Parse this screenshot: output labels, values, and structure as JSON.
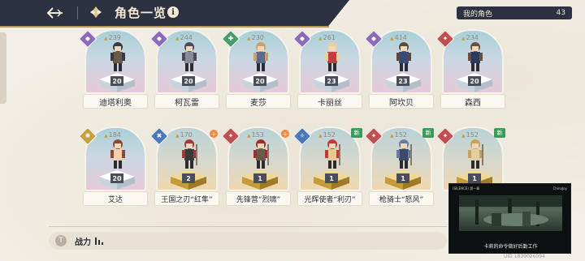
{
  "header": {
    "title": "角色一览",
    "info_symbol": "i"
  },
  "my_roles": {
    "label": "我的角色",
    "count": "43"
  },
  "row1": [
    {
      "name": "迪塔利奥",
      "power": "239",
      "level": "20",
      "class_icon": "magic-icon",
      "class_color": "purple"
    },
    {
      "name": "柯瓦雷",
      "power": "244",
      "level": "20",
      "class_icon": "magic-icon",
      "class_color": "purple"
    },
    {
      "name": "麦莎",
      "power": "230",
      "level": "20",
      "class_icon": "support-icon",
      "class_color": "green"
    },
    {
      "name": "卡丽丝",
      "power": "261",
      "level": "23",
      "class_icon": "magic-icon",
      "class_color": "purple"
    },
    {
      "name": "阿坎贝",
      "power": "414",
      "level": "23",
      "class_icon": "magic-icon",
      "class_color": "purple"
    },
    {
      "name": "森西",
      "power": "234",
      "level": "20",
      "class_icon": "attack-icon",
      "class_color": "red"
    }
  ],
  "row2": [
    {
      "name": "艾达",
      "power": "184",
      "level": "20",
      "class_icon": "sun-icon",
      "class_color": "gold",
      "tag": ""
    },
    {
      "name": "王国之刃“红隼”",
      "power": "170",
      "level": "2",
      "class_icon": "cross-icon",
      "class_color": "blue",
      "tag": "+"
    },
    {
      "name": "先锋营“烈啸”",
      "power": "153",
      "level": "1",
      "class_icon": "attack-icon",
      "class_color": "red",
      "tag": "+"
    },
    {
      "name": "光辉使者“利刃”",
      "power": "152",
      "level": "1",
      "class_icon": "swirl-icon",
      "class_color": "blue",
      "tag": "新"
    },
    {
      "name": "枪骑士“怒风”",
      "power": "152",
      "level": "1",
      "class_icon": "attack-icon",
      "class_color": "red",
      "tag": "新"
    },
    {
      "name": "",
      "power": "152",
      "level": "1",
      "class_icon": "attack-icon",
      "class_color": "red",
      "tag": "新"
    }
  ],
  "sort": {
    "label": "战力",
    "button_symbol": "T"
  },
  "video": {
    "top_left": "(SILENCE) 第一章",
    "top_right": "ChinaJoy",
    "caption": "卡莉的命令做好后勤工作"
  },
  "uid": "UID 1839026094",
  "colors": {
    "header_bg": "#2c3242",
    "accent": "#b89a5c",
    "page_bg": "#f3efe6"
  }
}
